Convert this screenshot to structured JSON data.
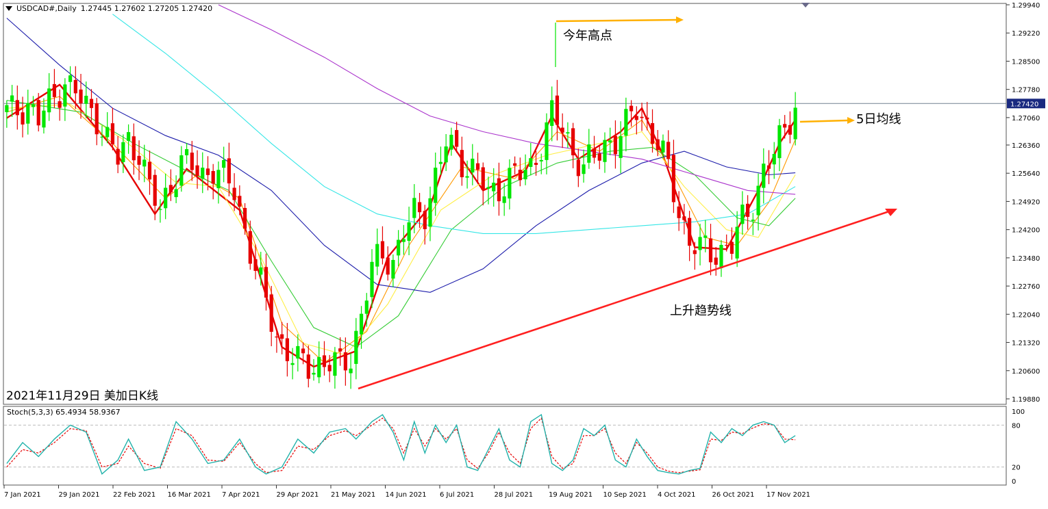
{
  "header": {
    "symbol": "USDCAD#,Daily",
    "ohlc": "1.27445 1.27602 1.27205 1.27420"
  },
  "caption": "2021年11月29日 美加日K线",
  "annotations": {
    "year_high": "今年高点",
    "ma5": "5日均线",
    "trendline": "上升趋势线"
  },
  "stoch_label": "Stoch(5,3,3) 65.4934 58.9367",
  "colors": {
    "bull": "#00e600",
    "bear": "#e60000",
    "ma5": "#e60000",
    "ma10": "#ff9900",
    "ma20": "#ffee44",
    "ma30": "#33cc33",
    "ma60": "#1a1aaa",
    "ma120": "#33e6e6",
    "ma250": "#aa33cc",
    "trend": "#ff2020",
    "arrow": "#ffb000",
    "stoch_main": "#20b2aa",
    "stoch_signal": "#e60000"
  },
  "chart_data": {
    "type": "candlestick",
    "y_ticks": [
      "1.29940",
      "1.29220",
      "1.28500",
      "1.27780",
      "1.27060",
      "1.26360",
      "1.25640",
      "1.24920",
      "1.24200",
      "1.23480",
      "1.22760",
      "1.22040",
      "1.21320",
      "1.20600",
      "1.19880"
    ],
    "current_price": "1.27420",
    "ylim": [
      1.1988,
      1.2994
    ],
    "x_ticks": [
      "7 Jan 2021",
      "29 Jan 2021",
      "22 Feb 2021",
      "16 Mar 2021",
      "7 Apr 2021",
      "29 Apr 2021",
      "21 May 2021",
      "14 Jun 2021",
      "6 Jul 2021",
      "28 Jul 2021",
      "19 Aug 2021",
      "10 Sep 2021",
      "4 Oct 2021",
      "26 Oct 2021",
      "17 Nov 2021"
    ],
    "close_path": [
      [
        1,
        1.272
      ],
      [
        4,
        1.274
      ],
      [
        6,
        1.27
      ],
      [
        9,
        1.276
      ],
      [
        11,
        1.28
      ],
      [
        13,
        1.277
      ],
      [
        15,
        1.273
      ],
      [
        17,
        1.271
      ],
      [
        19,
        1.265
      ],
      [
        21,
        1.26
      ],
      [
        23,
        1.265
      ],
      [
        25,
        1.262
      ],
      [
        27,
        1.252
      ],
      [
        29,
        1.247
      ],
      [
        31,
        1.254
      ],
      [
        33,
        1.259
      ],
      [
        35,
        1.258
      ],
      [
        37,
        1.256
      ],
      [
        39,
        1.258
      ],
      [
        41,
        1.255
      ],
      [
        43,
        1.252
      ],
      [
        45,
        1.242
      ],
      [
        47,
        1.232
      ],
      [
        49,
        1.223
      ],
      [
        51,
        1.215
      ],
      [
        53,
        1.211
      ],
      [
        55,
        1.208
      ],
      [
        57,
        1.207
      ],
      [
        59,
        1.208
      ],
      [
        61,
        1.208
      ],
      [
        63,
        1.207
      ],
      [
        65,
        1.21
      ],
      [
        67,
        1.22
      ],
      [
        69,
        1.232
      ],
      [
        71,
        1.236
      ],
      [
        73,
        1.234
      ],
      [
        75,
        1.241
      ],
      [
        77,
        1.246
      ],
      [
        79,
        1.247
      ],
      [
        81,
        1.255
      ],
      [
        83,
        1.264
      ],
      [
        85,
        1.262
      ],
      [
        87,
        1.258
      ],
      [
        89,
        1.256
      ],
      [
        91,
        1.251
      ],
      [
        93,
        1.253
      ],
      [
        95,
        1.255
      ],
      [
        97,
        1.256
      ],
      [
        99,
        1.258
      ],
      [
        101,
        1.264
      ],
      [
        103,
        1.271
      ],
      [
        105,
        1.268
      ],
      [
        107,
        1.262
      ],
      [
        109,
        1.258
      ],
      [
        111,
        1.26
      ],
      [
        113,
        1.264
      ],
      [
        115,
        1.265
      ],
      [
        117,
        1.268
      ],
      [
        119,
        1.273
      ],
      [
        121,
        1.269
      ],
      [
        123,
        1.264
      ],
      [
        125,
        1.257
      ],
      [
        127,
        1.247
      ],
      [
        129,
        1.239
      ],
      [
        131,
        1.237
      ],
      [
        133,
        1.236
      ],
      [
        135,
        1.237
      ],
      [
        137,
        1.238
      ],
      [
        139,
        1.244
      ],
      [
        141,
        1.249
      ],
      [
        143,
        1.257
      ],
      [
        145,
        1.261
      ],
      [
        147,
        1.268
      ],
      [
        149,
        1.2742
      ]
    ],
    "moving_averages": [
      {
        "name": "MA5",
        "color": "#e60000",
        "points": [
          [
            0,
            1.2705
          ],
          [
            10,
            1.279
          ],
          [
            20,
            1.263
          ],
          [
            28,
            1.246
          ],
          [
            34,
            1.2575
          ],
          [
            44,
            1.247
          ],
          [
            52,
            1.212
          ],
          [
            58,
            1.207
          ],
          [
            66,
            1.211
          ],
          [
            72,
            1.235
          ],
          [
            80,
            1.248
          ],
          [
            84,
            1.264
          ],
          [
            90,
            1.252
          ],
          [
            98,
            1.257
          ],
          [
            103,
            1.271
          ],
          [
            108,
            1.26
          ],
          [
            116,
            1.267
          ],
          [
            120,
            1.273
          ],
          [
            124,
            1.261
          ],
          [
            130,
            1.2375
          ],
          [
            136,
            1.237
          ],
          [
            142,
            1.252
          ],
          [
            146,
            1.264
          ],
          [
            149,
            1.27
          ]
        ]
      },
      {
        "name": "MA10",
        "color": "#ff9900",
        "points": [
          [
            0,
            1.272
          ],
          [
            10,
            1.276
          ],
          [
            20,
            1.264
          ],
          [
            30,
            1.25
          ],
          [
            36,
            1.256
          ],
          [
            44,
            1.25
          ],
          [
            52,
            1.218
          ],
          [
            60,
            1.208
          ],
          [
            68,
            1.216
          ],
          [
            76,
            1.238
          ],
          [
            86,
            1.258
          ],
          [
            96,
            1.255
          ],
          [
            104,
            1.267
          ],
          [
            112,
            1.262
          ],
          [
            120,
            1.27
          ],
          [
            126,
            1.256
          ],
          [
            132,
            1.24
          ],
          [
            138,
            1.238
          ],
          [
            144,
            1.249
          ],
          [
            149,
            1.265
          ]
        ]
      },
      {
        "name": "MA20",
        "color": "#ffee44",
        "points": [
          [
            0,
            1.273
          ],
          [
            12,
            1.274
          ],
          [
            22,
            1.265
          ],
          [
            32,
            1.254
          ],
          [
            40,
            1.253
          ],
          [
            48,
            1.235
          ],
          [
            56,
            1.213
          ],
          [
            64,
            1.21
          ],
          [
            72,
            1.223
          ],
          [
            82,
            1.247
          ],
          [
            92,
            1.256
          ],
          [
            102,
            1.261
          ],
          [
            112,
            1.264
          ],
          [
            120,
            1.267
          ],
          [
            128,
            1.253
          ],
          [
            136,
            1.242
          ],
          [
            142,
            1.24
          ],
          [
            149,
            1.256
          ]
        ]
      },
      {
        "name": "MA30",
        "color": "#33cc33",
        "points": [
          [
            0,
            1.275
          ],
          [
            14,
            1.272
          ],
          [
            24,
            1.264
          ],
          [
            34,
            1.257
          ],
          [
            42,
            1.252
          ],
          [
            50,
            1.234
          ],
          [
            58,
            1.217
          ],
          [
            66,
            1.212
          ],
          [
            74,
            1.22
          ],
          [
            84,
            1.242
          ],
          [
            94,
            1.253
          ],
          [
            104,
            1.259
          ],
          [
            114,
            1.262
          ],
          [
            122,
            1.263
          ],
          [
            130,
            1.256
          ],
          [
            138,
            1.245
          ],
          [
            144,
            1.243
          ],
          [
            149,
            1.25
          ]
        ]
      },
      {
        "name": "MA60",
        "color": "#1a1aaa",
        "points": [
          [
            0,
            1.296
          ],
          [
            10,
            1.284
          ],
          [
            20,
            1.273
          ],
          [
            30,
            1.266
          ],
          [
            40,
            1.261
          ],
          [
            50,
            1.252
          ],
          [
            60,
            1.238
          ],
          [
            70,
            1.228
          ],
          [
            80,
            1.226
          ],
          [
            90,
            1.232
          ],
          [
            100,
            1.243
          ],
          [
            110,
            1.252
          ],
          [
            120,
            1.259
          ],
          [
            128,
            1.262
          ],
          [
            136,
            1.258
          ],
          [
            144,
            1.256
          ],
          [
            149,
            1.2565
          ]
        ]
      },
      {
        "name": "MA120",
        "color": "#33e6e6",
        "points": [
          [
            20,
            1.297
          ],
          [
            30,
            1.287
          ],
          [
            40,
            1.276
          ],
          [
            50,
            1.264
          ],
          [
            60,
            1.253
          ],
          [
            70,
            1.246
          ],
          [
            80,
            1.243
          ],
          [
            90,
            1.241
          ],
          [
            100,
            1.241
          ],
          [
            110,
            1.242
          ],
          [
            120,
            1.243
          ],
          [
            130,
            1.244
          ],
          [
            140,
            1.246
          ],
          [
            149,
            1.253
          ]
        ]
      },
      {
        "name": "MA250",
        "color": "#aa33cc",
        "points": [
          [
            40,
            1.2994
          ],
          [
            50,
            1.293
          ],
          [
            60,
            1.286
          ],
          [
            70,
            1.278
          ],
          [
            80,
            1.271
          ],
          [
            90,
            1.267
          ],
          [
            100,
            1.264
          ],
          [
            110,
            1.262
          ],
          [
            120,
            1.26
          ],
          [
            130,
            1.256
          ],
          [
            140,
            1.252
          ],
          [
            149,
            1.251
          ]
        ]
      }
    ],
    "stoch_ticks": [
      "100",
      "80",
      "20",
      "0"
    ],
    "stoch_main": [
      [
        0,
        25
      ],
      [
        3,
        55
      ],
      [
        6,
        35
      ],
      [
        9,
        60
      ],
      [
        12,
        80
      ],
      [
        15,
        70
      ],
      [
        18,
        10
      ],
      [
        21,
        30
      ],
      [
        23,
        60
      ],
      [
        26,
        15
      ],
      [
        29,
        20
      ],
      [
        32,
        85
      ],
      [
        35,
        60
      ],
      [
        38,
        25
      ],
      [
        41,
        30
      ],
      [
        44,
        60
      ],
      [
        47,
        20
      ],
      [
        49,
        10
      ],
      [
        52,
        20
      ],
      [
        55,
        60
      ],
      [
        58,
        40
      ],
      [
        61,
        70
      ],
      [
        64,
        75
      ],
      [
        66,
        60
      ],
      [
        69,
        85
      ],
      [
        71,
        95
      ],
      [
        73,
        70
      ],
      [
        75,
        30
      ],
      [
        77,
        85
      ],
      [
        79,
        40
      ],
      [
        81,
        80
      ],
      [
        83,
        55
      ],
      [
        85,
        80
      ],
      [
        87,
        20
      ],
      [
        89,
        15
      ],
      [
        91,
        45
      ],
      [
        93,
        75
      ],
      [
        95,
        30
      ],
      [
        97,
        20
      ],
      [
        99,
        85
      ],
      [
        101,
        95
      ],
      [
        103,
        25
      ],
      [
        105,
        15
      ],
      [
        107,
        30
      ],
      [
        109,
        75
      ],
      [
        111,
        65
      ],
      [
        113,
        80
      ],
      [
        115,
        30
      ],
      [
        117,
        20
      ],
      [
        119,
        60
      ],
      [
        121,
        35
      ],
      [
        123,
        15
      ],
      [
        125,
        12
      ],
      [
        127,
        10
      ],
      [
        129,
        15
      ],
      [
        131,
        18
      ],
      [
        133,
        70
      ],
      [
        135,
        55
      ],
      [
        137,
        75
      ],
      [
        139,
        65
      ],
      [
        141,
        80
      ],
      [
        143,
        85
      ],
      [
        145,
        80
      ],
      [
        147,
        55
      ],
      [
        149,
        65
      ]
    ],
    "stoch_signal": [
      [
        0,
        20
      ],
      [
        3,
        45
      ],
      [
        6,
        40
      ],
      [
        9,
        55
      ],
      [
        12,
        75
      ],
      [
        15,
        72
      ],
      [
        18,
        20
      ],
      [
        21,
        25
      ],
      [
        23,
        50
      ],
      [
        26,
        25
      ],
      [
        29,
        18
      ],
      [
        32,
        75
      ],
      [
        35,
        65
      ],
      [
        38,
        30
      ],
      [
        41,
        28
      ],
      [
        44,
        55
      ],
      [
        47,
        25
      ],
      [
        49,
        12
      ],
      [
        52,
        15
      ],
      [
        55,
        50
      ],
      [
        58,
        45
      ],
      [
        61,
        65
      ],
      [
        64,
        72
      ],
      [
        66,
        65
      ],
      [
        69,
        80
      ],
      [
        71,
        90
      ],
      [
        73,
        75
      ],
      [
        75,
        40
      ],
      [
        77,
        75
      ],
      [
        79,
        50
      ],
      [
        81,
        75
      ],
      [
        83,
        60
      ],
      [
        85,
        75
      ],
      [
        87,
        30
      ],
      [
        89,
        18
      ],
      [
        91,
        40
      ],
      [
        93,
        70
      ],
      [
        95,
        40
      ],
      [
        97,
        25
      ],
      [
        99,
        75
      ],
      [
        101,
        90
      ],
      [
        103,
        35
      ],
      [
        105,
        18
      ],
      [
        107,
        25
      ],
      [
        109,
        65
      ],
      [
        111,
        65
      ],
      [
        113,
        75
      ],
      [
        115,
        40
      ],
      [
        117,
        25
      ],
      [
        119,
        55
      ],
      [
        121,
        40
      ],
      [
        123,
        20
      ],
      [
        125,
        14
      ],
      [
        127,
        12
      ],
      [
        129,
        14
      ],
      [
        131,
        16
      ],
      [
        133,
        60
      ],
      [
        135,
        58
      ],
      [
        137,
        70
      ],
      [
        139,
        68
      ],
      [
        141,
        76
      ],
      [
        143,
        82
      ],
      [
        145,
        80
      ],
      [
        147,
        60
      ],
      [
        149,
        59
      ]
    ]
  }
}
